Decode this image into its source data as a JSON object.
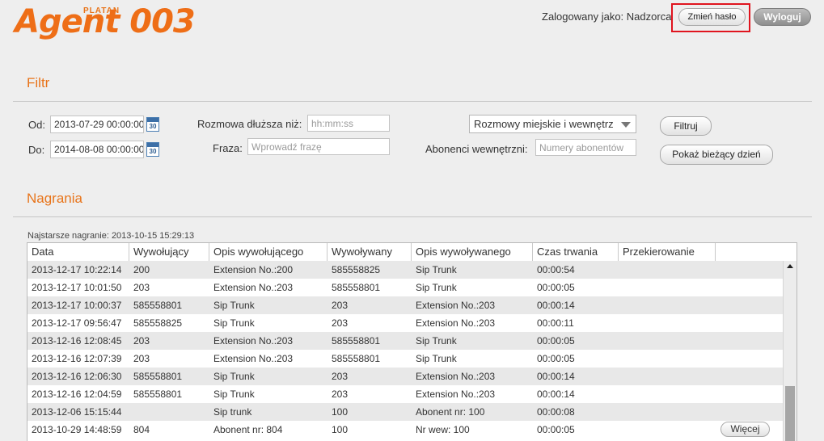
{
  "header": {
    "logo_brand": "PLATAN",
    "logo_product": "Agent 003",
    "logged_in_as": "Zalogowany jako: Nadzorca",
    "change_password_label": "Zmień hasło",
    "logout_label": "Wyloguj",
    "highlight_color": "#e0141e",
    "accent_color": "#ee6e17"
  },
  "filter": {
    "title": "Filtr",
    "from_label": "Od:",
    "from_value": "2013-07-29 00:00:00",
    "to_label": "Do:",
    "to_value": "2014-08-08 00:00:00",
    "calendar_icon_text": "30",
    "duration_label": "Rozmowa dłuższa niż:",
    "duration_placeholder": "hh:mm:ss",
    "phrase_label": "Fraza:",
    "phrase_placeholder": "Wprowadź frazę",
    "call_type_selected": "Rozmowy miejskie i wewnętrz",
    "internal_label": "Abonenci wewnętrzni:",
    "internal_placeholder": "Numery abonentów",
    "filter_button": "Filtruj",
    "today_button": "Pokaż bieżący dzień"
  },
  "recordings": {
    "title": "Nagrania",
    "oldest_note": "Najstarsze nagranie: 2013-10-15 15:29:13",
    "columns": [
      "Data",
      "Wywołujący",
      "Opis wywołującego",
      "Wywoływany",
      "Opis wywoływanego",
      "Czas trwania",
      "Przekierowanie",
      ""
    ],
    "rows": [
      [
        "2013-12-17 10:22:14",
        "200",
        "Extension No.:200",
        "585558825",
        "Sip Trunk",
        "00:00:54",
        "",
        ""
      ],
      [
        "2013-12-17 10:01:50",
        "203",
        "Extension No.:203",
        "585558801",
        "Sip Trunk",
        "00:00:05",
        "",
        ""
      ],
      [
        "2013-12-17 10:00:37",
        "585558801",
        "Sip Trunk",
        "203",
        "Extension No.:203",
        "00:00:14",
        "",
        ""
      ],
      [
        "2013-12-17 09:56:47",
        "585558825",
        "Sip Trunk",
        "203",
        "Extension No.:203",
        "00:00:11",
        "",
        ""
      ],
      [
        "2013-12-16 12:08:45",
        "203",
        "Extension No.:203",
        "585558801",
        "Sip Trunk",
        "00:00:05",
        "",
        ""
      ],
      [
        "2013-12-16 12:07:39",
        "203",
        "Extension No.:203",
        "585558801",
        "Sip Trunk",
        "00:00:05",
        "",
        ""
      ],
      [
        "2013-12-16 12:06:30",
        "585558801",
        "Sip Trunk",
        "203",
        "Extension No.:203",
        "00:00:14",
        "",
        ""
      ],
      [
        "2013-12-16 12:04:59",
        "585558801",
        "Sip Trunk",
        "203",
        "Extension No.:203",
        "00:00:14",
        "",
        ""
      ],
      [
        "2013-12-06 15:15:44",
        "",
        "Sip trunk",
        "100",
        "Abonent nr: 100",
        "00:00:08",
        "",
        ""
      ],
      [
        "2013-10-29 14:48:59",
        "804",
        "Abonent nr: 804",
        "100",
        "Nr wew: 100",
        "00:00:05",
        "",
        "Więcej"
      ]
    ]
  }
}
